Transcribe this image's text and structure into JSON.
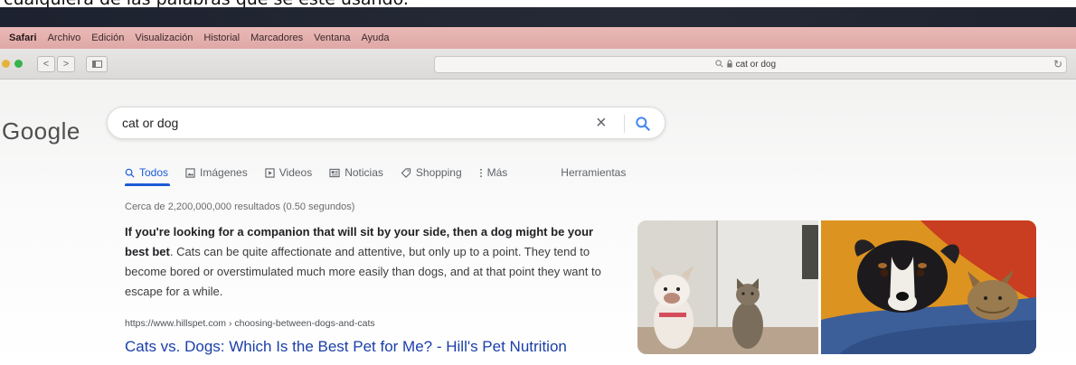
{
  "caption": {
    "text": "cualquiera de las palabras que se esté usando."
  },
  "menubar": {
    "items": [
      "Safari",
      "Archivo",
      "Edición",
      "Visualización",
      "Historial",
      "Marcadores",
      "Ventana",
      "Ayuda"
    ]
  },
  "toolbar": {
    "back_icon": "<",
    "forward_icon": ">",
    "address": "cat or dog",
    "reload_icon": "↻"
  },
  "google": {
    "logo": "Google",
    "search": {
      "value": "cat or dog",
      "clear_icon": "×"
    },
    "tabs": [
      {
        "label": "Todos",
        "icon": "search-icon"
      },
      {
        "label": "Imágenes",
        "icon": "image-icon"
      },
      {
        "label": "Videos",
        "icon": "play-icon"
      },
      {
        "label": "Noticias",
        "icon": "news-icon"
      },
      {
        "label": "Shopping",
        "icon": "tag-icon"
      },
      {
        "label": "Más",
        "icon": "more-icon"
      },
      {
        "label": "Herramientas",
        "icon": ""
      }
    ],
    "stats": "Cerca de 2,200,000,000 resultados (0.50 segundos)",
    "snippet": {
      "bold": "If you're looking for a companion that will sit by your side, then a dog might be your best bet",
      "rest": ". Cats can be quite affectionate and attentive, but only up to a point. They tend to become bored or overstimulated much more easily than dogs, and at that point they want to escape for a while."
    },
    "result": {
      "cite": "https://www.hillspet.com › choosing-between-dogs-and-cats",
      "title": "Cats vs. Dogs: Which Is the Best Pet for Me? - Hill's Pet Nutrition"
    }
  },
  "colors": {
    "accent": "#1a5bd6",
    "link": "#1a3fa8",
    "menubar": "#e2aeac"
  }
}
